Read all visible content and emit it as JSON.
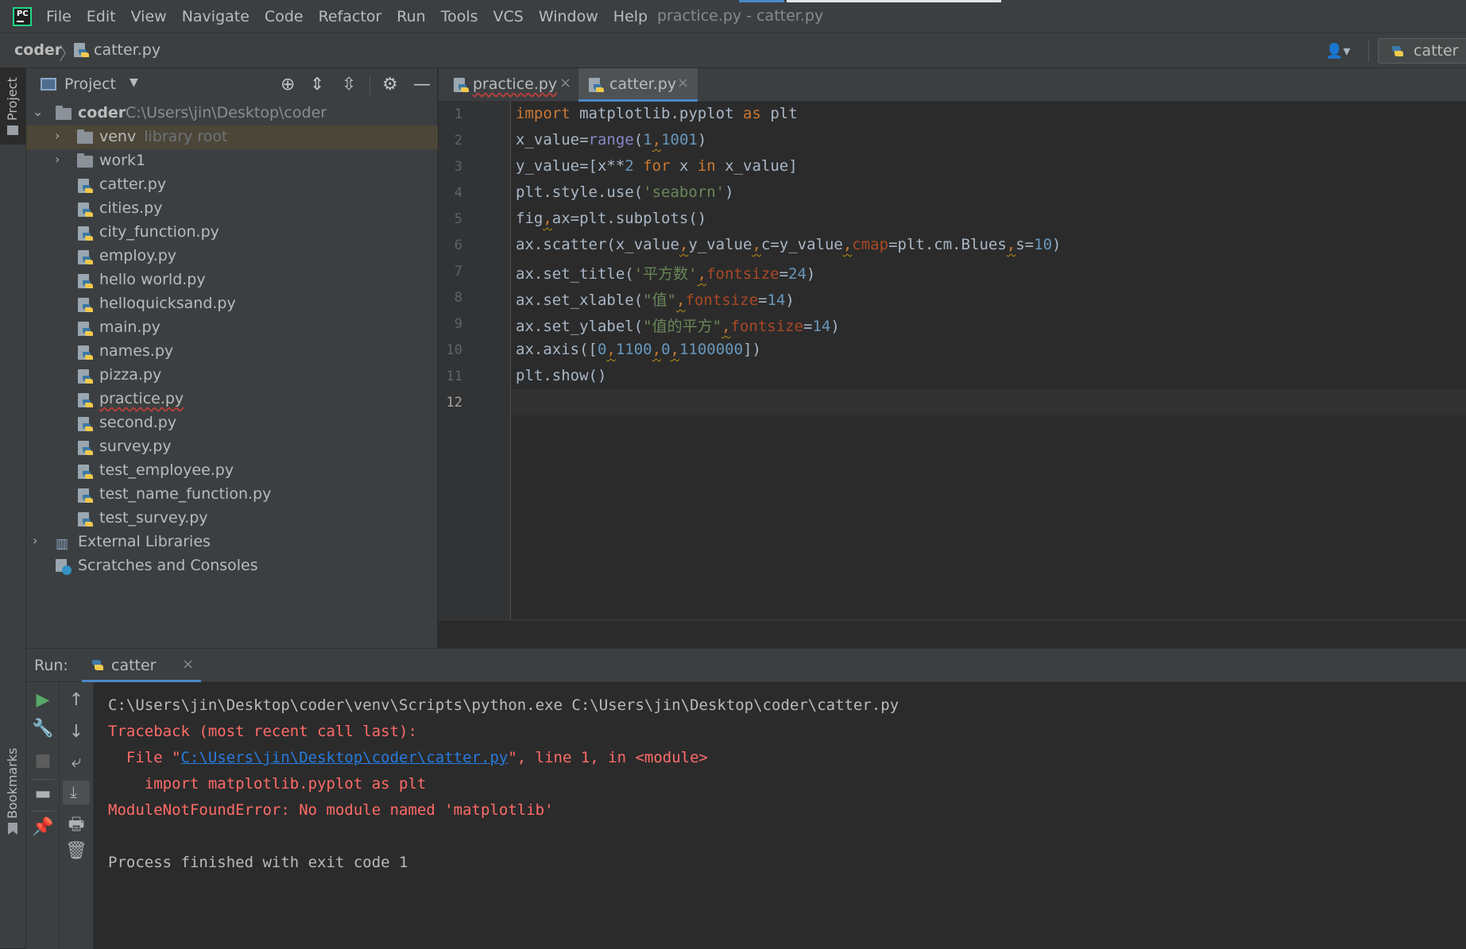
{
  "menubar": {
    "logo_text": "PC",
    "items": [
      "File",
      "Edit",
      "View",
      "Navigate",
      "Code",
      "Refactor",
      "Run",
      "Tools",
      "VCS",
      "Window",
      "Help"
    ],
    "window_title": "practice.py - catter.py"
  },
  "navbar": {
    "project": "coder",
    "file": "catter.py",
    "run_config": "catter"
  },
  "stripe": {
    "project_tab": "Project",
    "bookmarks_tab": "Bookmarks"
  },
  "project_panel": {
    "title": "Project",
    "root": {
      "name": "coder",
      "path": "C:\\Users\\jin\\Desktop\\coder"
    },
    "folders": [
      {
        "name": "venv",
        "hint": "library root"
      },
      {
        "name": "work1",
        "hint": ""
      }
    ],
    "files": [
      "catter.py",
      "cities.py",
      "city_function.py",
      "employ.py",
      "hello world.py",
      "helloquicksand.py",
      "main.py",
      "names.py",
      "pizza.py",
      "practice.py",
      "second.py",
      "survey.py",
      "test_employee.py",
      "test_name_function.py",
      "test_survey.py"
    ],
    "external_libraries": "External Libraries",
    "scratches": "Scratches and Consoles"
  },
  "editor": {
    "tabs": [
      "practice.py",
      "catter.py"
    ],
    "active_tab": "catter.py",
    "line_numbers": [
      "1",
      "2",
      "3",
      "4",
      "5",
      "6",
      "7",
      "8",
      "9",
      "10",
      "11",
      "12"
    ],
    "current_line": 12,
    "code_lines": [
      "import matplotlib.pyplot as plt",
      "x_value=range(1,1001)",
      "y_value=[x**2 for x in x_value]",
      "plt.style.use('seaborn')",
      "fig,ax=plt.subplots()",
      "ax.scatter(x_value,y_value,c=y_value,cmap=plt.cm.Blues,s=10)",
      "ax.set_title('平方数',fontsize=24)",
      "ax.set_xlable(\"值\",fontsize=14)",
      "ax.set_ylabel(\"值的平方\",fontsize=14)",
      "ax.axis([0,1100,0,1100000])",
      "plt.show()",
      ""
    ]
  },
  "run": {
    "title": "Run:",
    "tab": "catter",
    "console": {
      "command": "C:\\Users\\jin\\Desktop\\coder\\venv\\Scripts\\python.exe C:\\Users\\jin\\Desktop\\coder\\catter.py",
      "traceback": "Traceback (most recent call last):",
      "file_prefix": "  File \"",
      "file_link": "C:\\Users\\jin\\Desktop\\coder\\catter.py",
      "file_suffix": "\", line 1, in <module>",
      "source_line": "    import matplotlib.pyplot as plt",
      "error": "ModuleNotFoundError: No module named 'matplotlib'",
      "exit": "Process finished with exit code 1"
    }
  },
  "colors": {
    "keyword": "#cc7832",
    "number": "#6897bb",
    "string": "#6a8759",
    "param": "#aa4926",
    "error": "#ff6b68",
    "link": "#287bde",
    "accent": "#4a88c7"
  }
}
